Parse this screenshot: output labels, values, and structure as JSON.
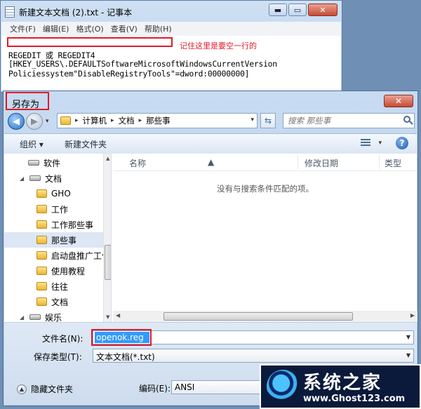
{
  "notepad": {
    "title": "新建文本文档 (2).txt - 记事本",
    "controls": {
      "minimize": "▬",
      "maximize": "▭",
      "close": "✕"
    },
    "menu": [
      "文件(F)",
      "编辑(E)",
      "格式(O)",
      "查看(V)",
      "帮助(H)"
    ],
    "note": "记住这里是要空一行的",
    "lines": [
      "REGEDIT 或 REGEDIT4",
      "[HKEY_USERS\\.DEFAULTSoftwareMicrosoftWindowsCurrentVersion",
      "Policiessystem\"DisableRegistryTools\"=dword:00000000]"
    ]
  },
  "dialog": {
    "title": "另存为",
    "close": "✕",
    "nav": {
      "back": "◀",
      "forward": "▶",
      "dropdown": "▾"
    },
    "address": [
      "计算机",
      "文档",
      "那些事"
    ],
    "address_sep": "▸",
    "search_placeholder": "搜索 那些事",
    "toolbar": {
      "organize": "组织 ▾",
      "new_folder": "新建文件夹",
      "help": "?"
    },
    "tree": [
      {
        "label": "软件",
        "kind": "drive"
      },
      {
        "label": "文档",
        "kind": "drive"
      },
      {
        "label": "GHO",
        "kind": "folder"
      },
      {
        "label": "工作",
        "kind": "folder"
      },
      {
        "label": "工作那些事",
        "kind": "folder"
      },
      {
        "label": "那些事",
        "kind": "folder",
        "selected": true
      },
      {
        "label": "启动盘推广工作",
        "kind": "folder"
      },
      {
        "label": "使用教程",
        "kind": "folder"
      },
      {
        "label": "往往",
        "kind": "folder"
      },
      {
        "label": "文档",
        "kind": "folder"
      },
      {
        "label": "娱乐",
        "kind": "drive"
      }
    ],
    "columns": [
      "名称",
      "修改日期",
      "类型"
    ],
    "empty_message": "没有与搜索条件匹配的项。",
    "filename_label": "文件名(N):",
    "filename_value": "openok.reg",
    "filetype_label": "保存类型(T):",
    "filetype_value": "文本文档(*.txt)",
    "hide_folders": "隐藏文件夹",
    "encoding_label": "编码(E):",
    "encoding_value": "ANSI"
  },
  "watermark": {
    "title": "系统之家",
    "url": "www.Ghost123.com"
  },
  "colors": {
    "highlight_box": "#e0192a",
    "selection": "#3399ff"
  }
}
